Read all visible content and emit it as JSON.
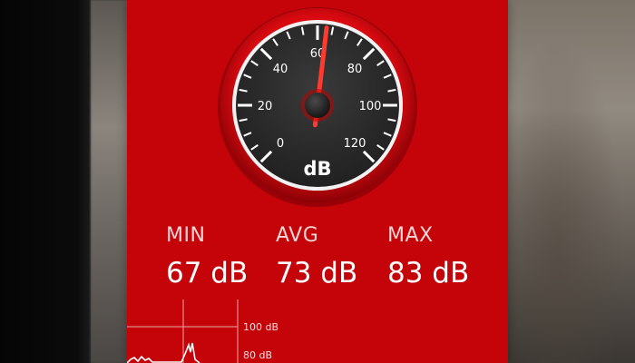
{
  "gauge": {
    "unit": "dB",
    "scale_labels": [
      "0",
      "20",
      "40",
      "60",
      "80",
      "100",
      "120"
    ],
    "min": 0,
    "max": 120,
    "reading": 63
  },
  "stats": {
    "min_label": "MIN",
    "min_value": "67 dB",
    "avg_label": "AVG",
    "avg_value": "73 dB",
    "max_label": "MAX",
    "max_value": "83 dB"
  },
  "graph": {
    "labels": [
      "100 dB",
      "80 dB"
    ]
  },
  "colors": {
    "panel": "#c5040a",
    "needle": "#ff3b30",
    "dial_face": "#2b2b2b"
  }
}
